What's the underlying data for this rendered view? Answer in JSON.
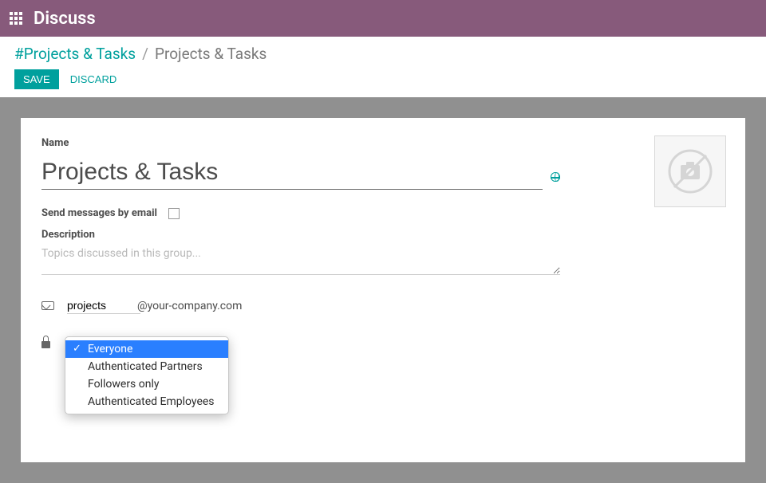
{
  "nav": {
    "title": "Discuss"
  },
  "breadcrumb": {
    "root": "#Projects & Tasks",
    "separator": "/",
    "current": "Projects & Tasks"
  },
  "actions": {
    "save": "SAVE",
    "discard": "DISCARD"
  },
  "form": {
    "name_label": "Name",
    "name_value": "Projects & Tasks",
    "send_email_label": "Send messages by email",
    "send_email_checked": false,
    "description_label": "Description",
    "description_placeholder": "Topics discussed in this group...",
    "description_value": "",
    "email_alias": "projects",
    "email_domain": "@your-company.com",
    "privacy": {
      "selected": "Everyone",
      "options": [
        "Everyone",
        "Authenticated Partners",
        "Followers only",
        "Authenticated Employees"
      ]
    }
  }
}
